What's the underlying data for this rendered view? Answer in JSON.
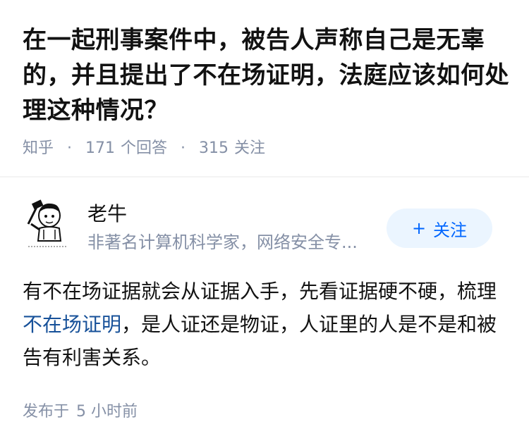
{
  "question": {
    "title": "在一起刑事案件中，被告人声称自己是无辜的，并且提出了不在场证明，法庭应该如何处理这种情况？",
    "source": "知乎",
    "answer_count": "171",
    "answer_label": "个回答",
    "follow_count": "315",
    "follow_label": "关注"
  },
  "author": {
    "name": "老牛",
    "bio": "非著名计算机科学家，网络安全专...",
    "avatar_icon": "cartoon-avatar",
    "follow_button_icon": "plus-icon",
    "follow_button_label": "关注"
  },
  "answer": {
    "text_before": "有不在场证据就会从证据入手，先看证据硬不硬，梳理",
    "link_text": "不在场证明",
    "text_after": "，是人证还是物证，人证里的人是不是和被告有利害关系。"
  },
  "footer": {
    "published_label": "发布于",
    "published_time": "5 小时前"
  },
  "colors": {
    "meta_gray": "#8590a6",
    "link_blue": "#175199",
    "button_blue": "#0066ff",
    "button_bg": "#ebf5ff"
  }
}
